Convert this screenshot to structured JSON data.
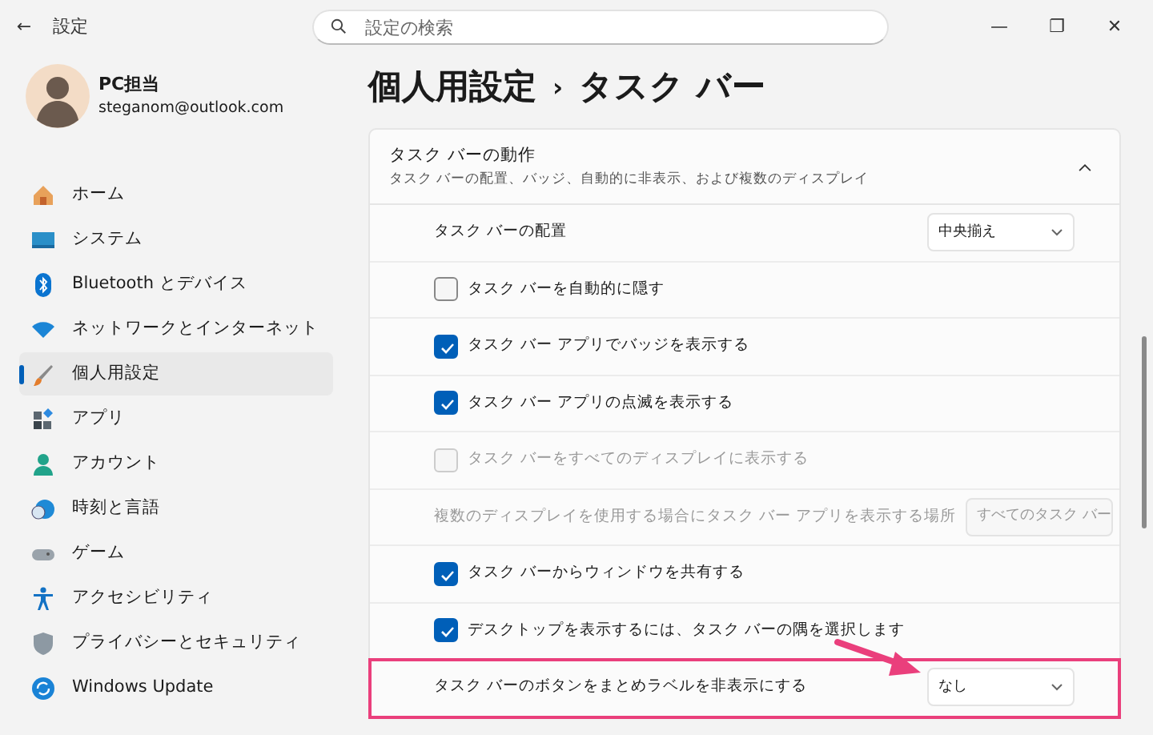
{
  "window": {
    "title": "設定",
    "back": "←",
    "controls": [
      "—",
      "❐",
      "✕"
    ]
  },
  "search": {
    "placeholder": "設定の検索"
  },
  "account": {
    "name": "PC担当",
    "email": "steganom@outlook.com"
  },
  "sidebar": {
    "items": [
      {
        "label": "ホーム",
        "selected": false
      },
      {
        "label": "システム",
        "selected": false
      },
      {
        "label": "Bluetooth とデバイス",
        "selected": false
      },
      {
        "label": "ネットワークとインターネット",
        "selected": false
      },
      {
        "label": "個人用設定",
        "selected": true
      },
      {
        "label": "アプリ",
        "selected": false
      },
      {
        "label": "アカウント",
        "selected": false
      },
      {
        "label": "時刻と言語",
        "selected": false
      },
      {
        "label": "ゲーム",
        "selected": false
      },
      {
        "label": "アクセシビリティ",
        "selected": false
      },
      {
        "label": "プライバシーとセキュリティ",
        "selected": false
      },
      {
        "label": "Windows Update",
        "selected": false
      }
    ]
  },
  "breadcrumb": {
    "parts": [
      "個人用設定",
      "タスク バー"
    ],
    "separator": "›"
  },
  "section": {
    "title": "タスク バーの動作",
    "subtitle": "タスク バーの配置、バッジ、自動的に非表示、および複数のディスプレイ",
    "expanded": true,
    "rows": [
      {
        "kind": "dropdown",
        "label": "タスク バーの配置",
        "value": "中央揃え",
        "disabled": false,
        "highlighted": false
      },
      {
        "kind": "checkbox",
        "label": "タスク バーを自動的に隠す",
        "checked": false,
        "disabled": false
      },
      {
        "kind": "checkbox",
        "label": "タスク バー アプリでバッジを表示する",
        "checked": true,
        "disabled": false
      },
      {
        "kind": "checkbox",
        "label": "タスク バー アプリの点滅を表示する",
        "checked": true,
        "disabled": false
      },
      {
        "kind": "checkbox",
        "label": "タスク バーをすべてのディスプレイに表示する",
        "checked": false,
        "disabled": true
      },
      {
        "kind": "dropdown",
        "label": "複数のディスプレイを使用する場合にタスク バー アプリを表示する場所",
        "value": "すべてのタスク バー",
        "disabled": true,
        "highlighted": false
      },
      {
        "kind": "checkbox",
        "label": "タスク バーからウィンドウを共有する",
        "checked": true,
        "disabled": false
      },
      {
        "kind": "checkbox",
        "label": "デスクトップを表示するには、タスク バーの隅を選択します",
        "checked": true,
        "disabled": false
      },
      {
        "kind": "dropdown",
        "label": "タスク バーのボタンをまとめラベルを非表示にする",
        "value": "なし",
        "disabled": false,
        "highlighted": true
      }
    ]
  }
}
